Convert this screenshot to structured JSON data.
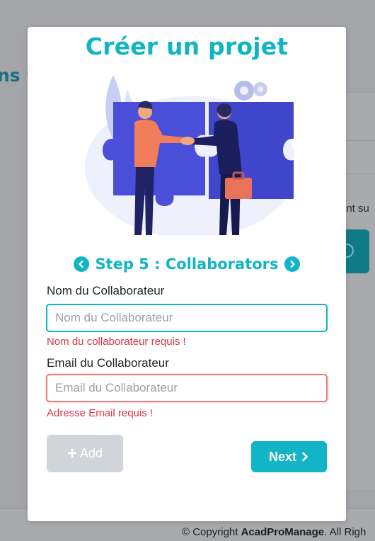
{
  "background": {
    "heading_fragment": "ns v",
    "side_text_fragment": "ant su",
    "footer": {
      "prefix": "© Copyright ",
      "brand": "AcadProManage",
      "suffix": ". All Righ"
    }
  },
  "modal": {
    "title": "Créer un projet",
    "illustration_icon": "puzzle-handshake-illustration",
    "step": {
      "title": "Step 5 : Collaborators",
      "prev_icon": "chevron-left-icon",
      "next_icon": "chevron-right-icon"
    },
    "fields": {
      "name": {
        "label": "Nom du Collaborateur",
        "placeholder": "Nom du Collaborateur",
        "value": "",
        "error": "Nom du collaborateur requis !"
      },
      "email": {
        "label": "Email du Collaborateur",
        "placeholder": "Email du Collaborateur",
        "value": "",
        "error": "Adresse Email requis !"
      }
    },
    "buttons": {
      "add": {
        "label": "Add",
        "icon": "plus-icon"
      },
      "next": {
        "label": "Next",
        "icon": "chevron-right-icon"
      }
    }
  },
  "colors": {
    "accent": "#12b5c6",
    "error": "#dc3545",
    "disabled": "#d1d4d9"
  }
}
